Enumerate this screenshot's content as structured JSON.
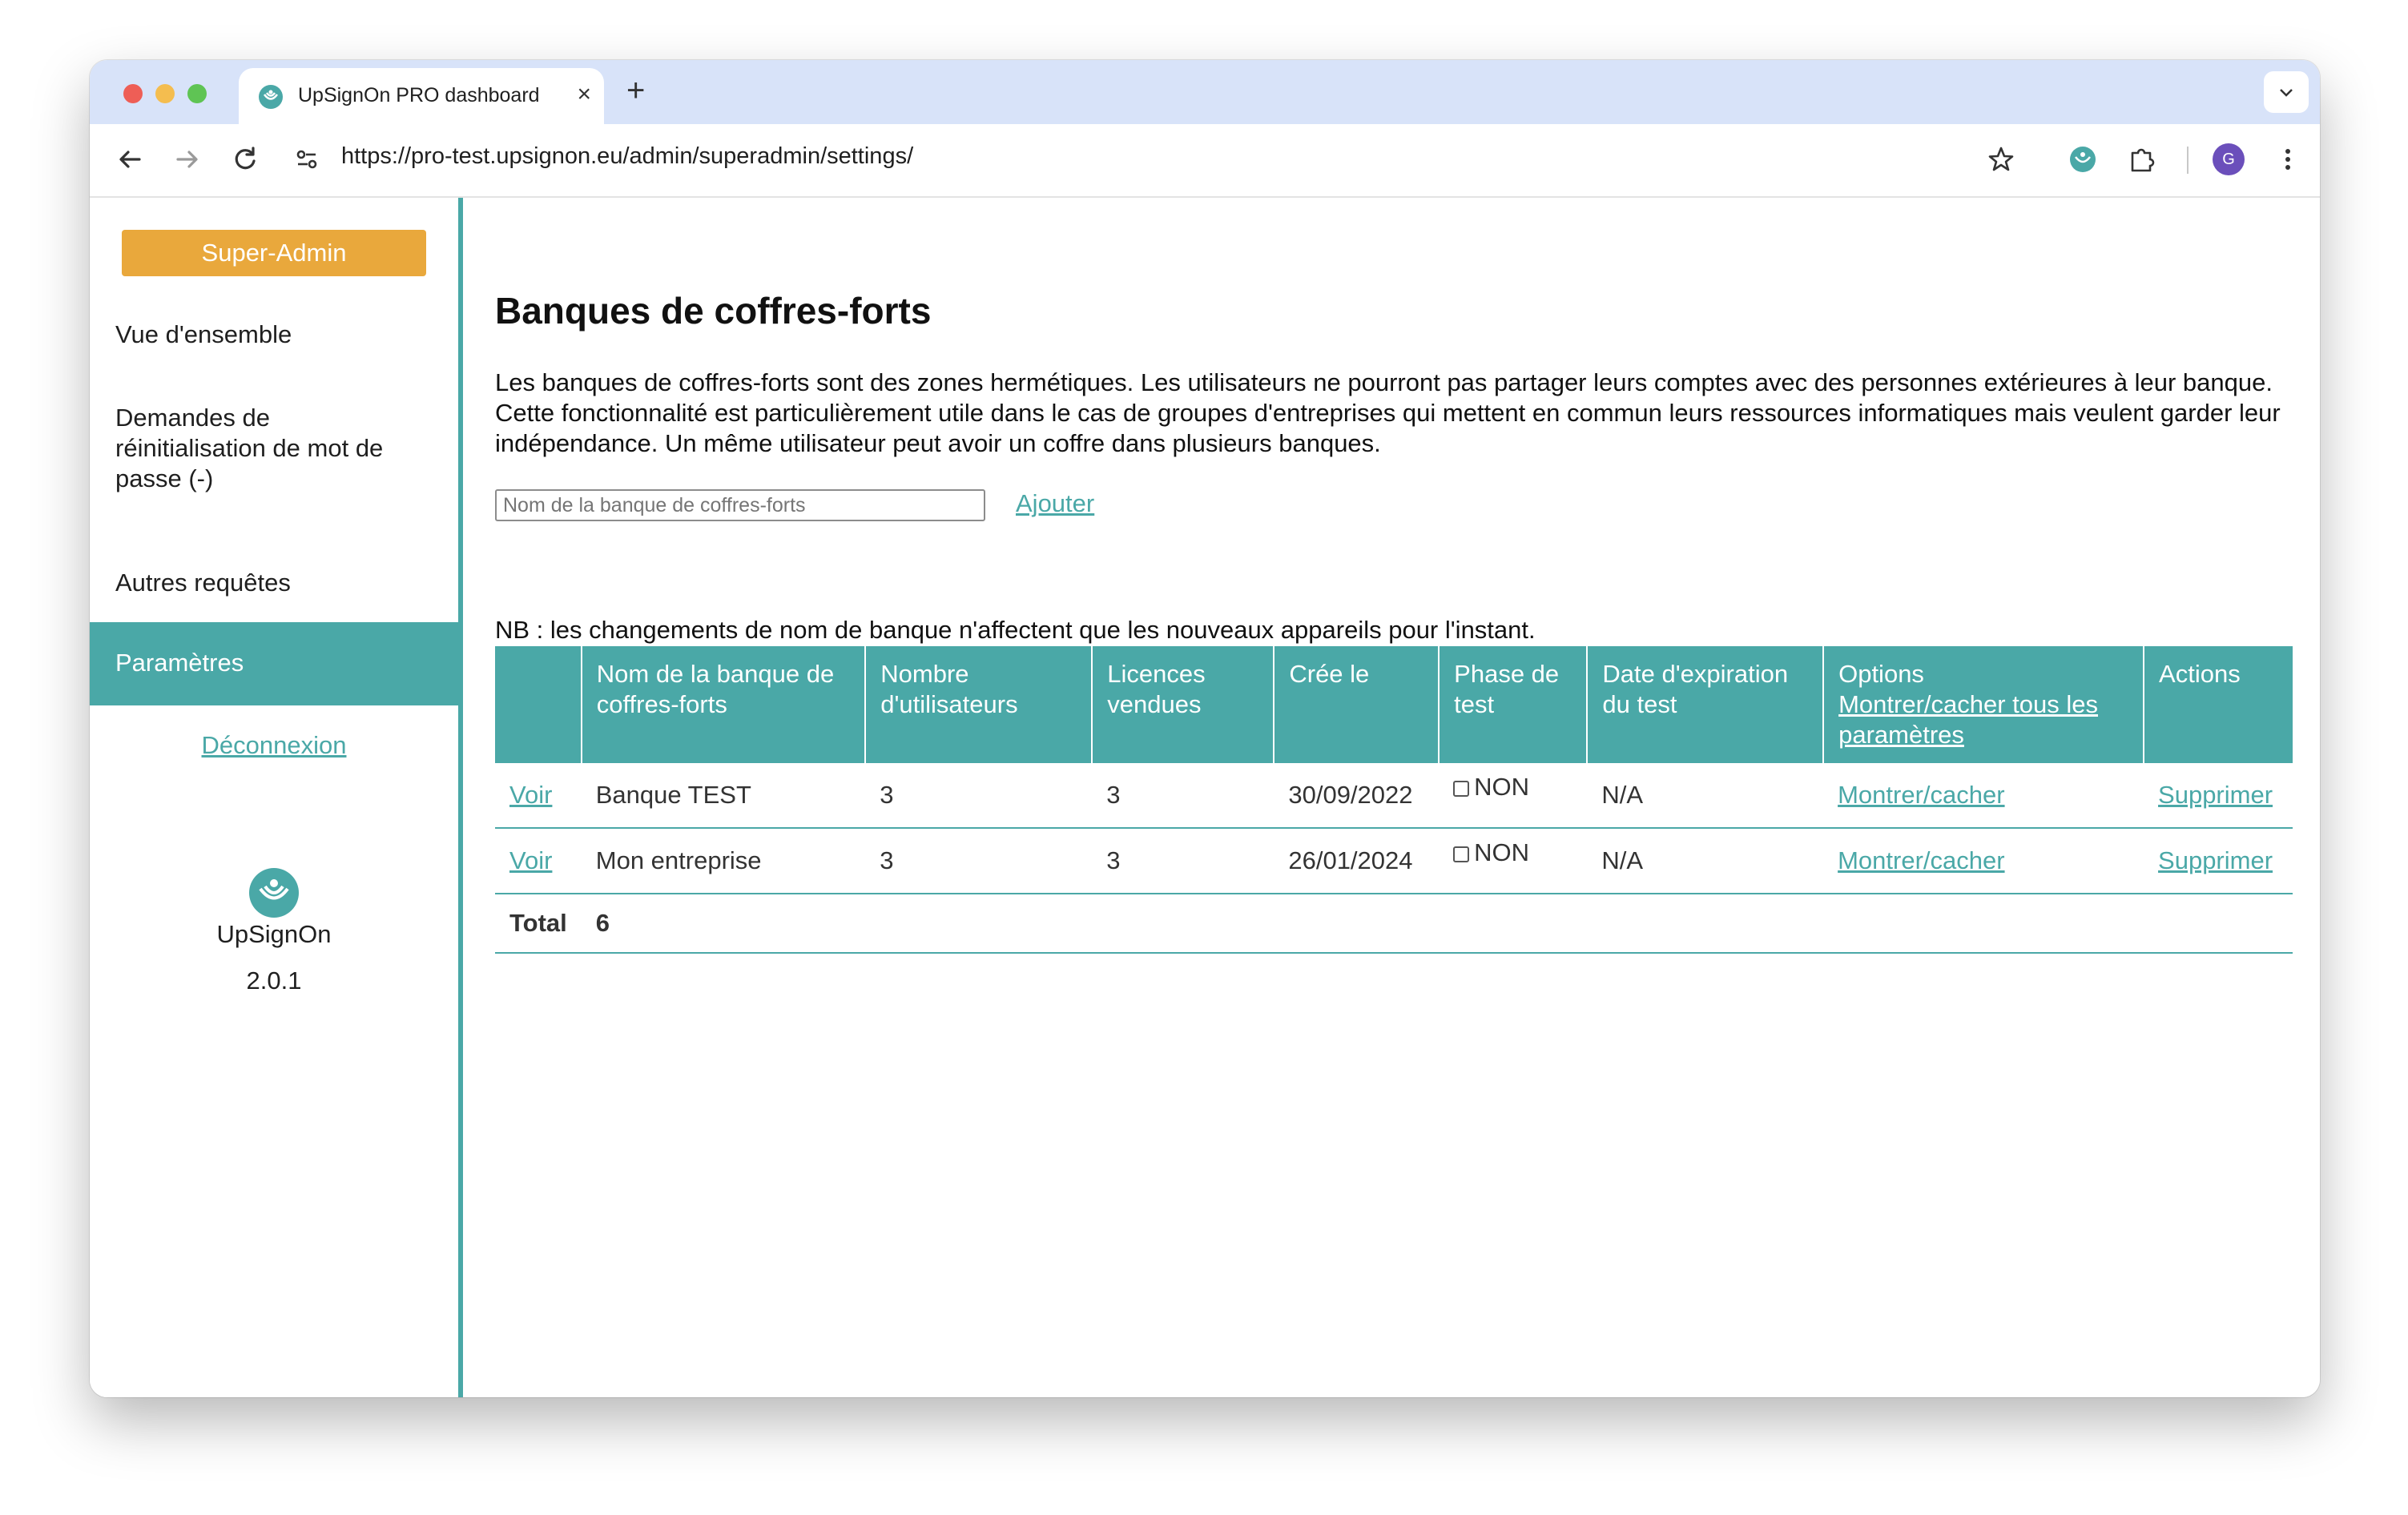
{
  "browser": {
    "tab_title": "UpSignOn PRO dashboard",
    "tab_close": "×",
    "new_tab": "+",
    "url": "https://pro-test.upsignon.eu/admin/superadmin/settings/",
    "avatar_letter": "G"
  },
  "sidebar": {
    "super_admin_label": "Super-Admin",
    "items": [
      {
        "label": "Vue d'ensemble"
      },
      {
        "label": "Demandes de réinitialisation de mot de passe (-)"
      },
      {
        "label": "Autres requêtes"
      },
      {
        "label": "Paramètres"
      }
    ],
    "logout_label": "Déconnexion",
    "brand_name": "UpSignOn",
    "version": "2.0.1"
  },
  "main": {
    "title": "Banques de coffres-forts",
    "description": "Les banques de coffres-forts sont des zones hermétiques. Les utilisateurs ne pourront pas partager leurs comptes avec des personnes extérieures à leur banque. Cette fonctionnalité est particulièrement utile dans le cas de groupes d'entreprises qui mettent en commun leurs ressources informatiques mais veulent garder leur indépendance. Un même utilisateur peut avoir un coffre dans plusieurs banques.",
    "input_placeholder": "Nom de la banque de coffres-forts",
    "add_label": "Ajouter",
    "note": "NB : les changements de nom de banque n'affectent que les nouveaux appareils pour l'instant."
  },
  "table": {
    "headers": {
      "name": "Nom de la banque de coffres-forts",
      "users": "Nombre d'utilisateurs",
      "licences": "Licences vendues",
      "created": "Crée le",
      "test_phase": "Phase de test",
      "test_expiry": "Date d'expiration du test",
      "options": "Options",
      "options_toggle_all": "Montrer/cacher tous les paramètres",
      "actions": "Actions"
    },
    "rows": [
      {
        "view": "Voir",
        "name": "Banque TEST",
        "users": "3",
        "licences": "3",
        "created": "30/09/2022",
        "test_phase": "NON",
        "test_expiry": "N/A",
        "options": "Montrer/cacher",
        "action": "Supprimer"
      },
      {
        "view": "Voir",
        "name": "Mon entreprise",
        "users": "3",
        "licences": "3",
        "created": "26/01/2024",
        "test_phase": "NON",
        "test_expiry": "N/A",
        "options": "Montrer/cacher",
        "action": "Supprimer"
      }
    ],
    "total_label": "Total",
    "total_value": "6"
  },
  "colors": {
    "accent": "#4aa8a7",
    "super_admin": "#e9a83c",
    "tabstrip": "#d8e3f9"
  }
}
